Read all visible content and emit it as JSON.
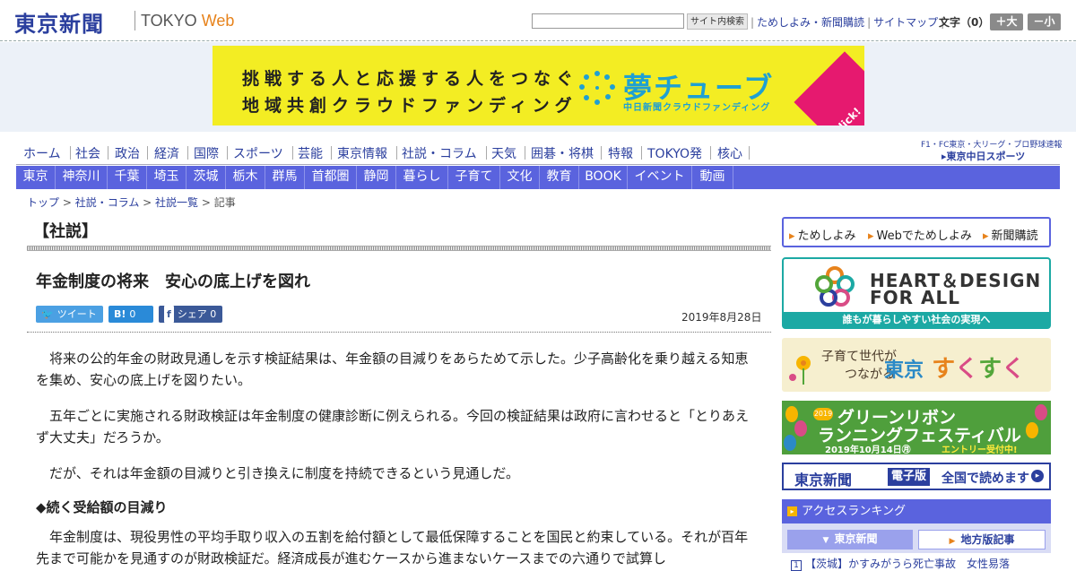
{
  "header": {
    "logo_jp": "東京新聞",
    "logo_en_prefix": "TOKYO",
    "logo_en_suffix": "Web",
    "search_button": "サイト内検索",
    "links": [
      "ためしよみ・新聞購読",
      "サイトマップ"
    ],
    "font_size_label": "文字（0）",
    "font_bigger": "＋大",
    "font_smaller": "－小"
  },
  "banner": {
    "line1": "挑戦する人と応援する人をつなぐ",
    "line2": "地域共創クラウドファンディング",
    "logo": "夢チューブ",
    "sub": "中日新聞クラウドファンディング",
    "click": "Click!"
  },
  "nav_main": [
    "ホーム",
    "社会",
    "政治",
    "経済",
    "国際",
    "スポーツ",
    "芸能",
    "東京情報",
    "社説・コラム",
    "天気",
    "囲碁・将棋",
    "特報",
    "TOKYO発",
    "核心"
  ],
  "sports_link": {
    "top": "F1・FC東京・大リーグ・プロ野球速報",
    "logo": "▸東京中日スポーツ"
  },
  "nav_region": [
    "東京",
    "神奈川",
    "千葉",
    "埼玉",
    "茨城",
    "栃木",
    "群馬",
    "首都圏",
    "静岡",
    "暮らし",
    "子育て",
    "文化",
    "教育",
    "BOOK",
    "イベント",
    "動画"
  ],
  "breadcrumb": {
    "items": [
      "トップ",
      "社説・コラム",
      "社説一覧"
    ],
    "current": "記事",
    "sep": " > "
  },
  "article": {
    "section": "【社説】",
    "title": "年金制度の将来　安心の底上げを図れ",
    "tweet": "ツイート",
    "hatena_count": "0",
    "share": "シェア",
    "share_count": "0",
    "date": "2019年8月28日",
    "paragraphs": [
      "将来の公的年金の財政見通しを示す検証結果は、年金額の目減りをあらためて示した。少子高齢化を乗り越える知恵を集め、安心の底上げを図りたい。",
      "五年ごとに実施される財政検証は年金制度の健康診断に例えられる。今回の検証結果は政府に言わせると「とりあえず大丈夫」だろうか。",
      "だが、それは年金額の目減りと引き換えに制度を持続できるという見通しだ。"
    ],
    "subheading": "◆続く受給額の目減り",
    "paragraph4": "年金制度は、現役男性の平均手取り収入の五割を給付額として最低保障することを国民と約束している。それが百年先まで可能かを見通すのが財政検証だ。経済成長が進むケースから進まないケースまでの六通りで試算し"
  },
  "sidebar": {
    "sub_links": [
      "ためしよみ",
      "Webでためしよみ",
      "新聞購読"
    ],
    "heart_design": {
      "line1": "HEART＆DESIGN",
      "line2": "FOR ALL",
      "bar": "誰もが暮らしやすい社会の実現へ"
    },
    "sukusuku": {
      "line1": "子育て世代が",
      "line2": "つながる",
      "city": "東京",
      "s1": "す",
      "s2": "く",
      "s3": "す",
      "s4": "く"
    },
    "green_ribbon": {
      "year": "2019",
      "line1": "グリーンリボン",
      "line2": "ランニングフェスティバル",
      "date": "2019年10月14日㊊",
      "entry": "エントリー受付中!"
    },
    "e_paper": {
      "logo": "東京新聞",
      "tag": "電子版",
      "text": "全国で読めます",
      "arrow": "▸"
    },
    "ranking": {
      "title": "アクセスランキング",
      "tabs": [
        "東京新聞",
        "地方版記事"
      ],
      "row_num": "1",
      "row_text": "【茨城】かすみがうら死亡事故　女性易落"
    }
  },
  "colors": {
    "brand_blue": "#2b3f9e",
    "nav_purple": "#5a63de",
    "web_orange": "#e7831c",
    "banner_yellow": "#f3ed23"
  }
}
